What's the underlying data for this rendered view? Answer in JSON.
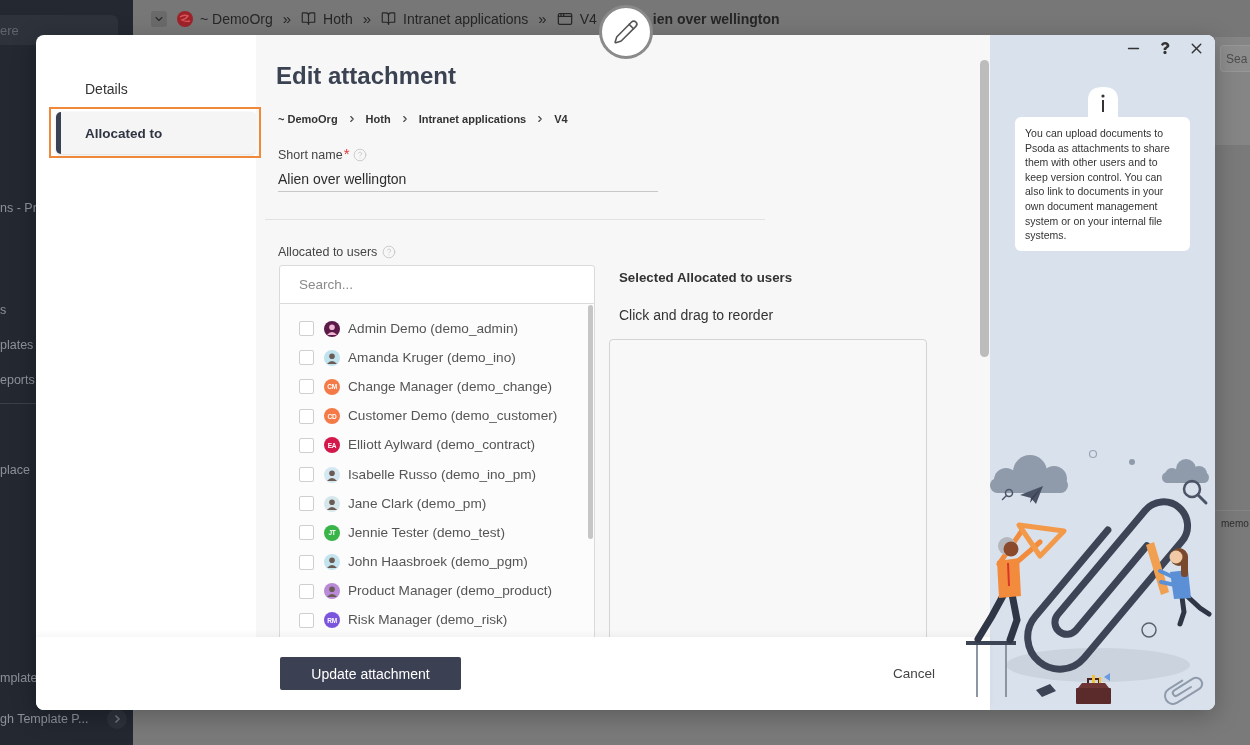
{
  "background": {
    "sidebar": {
      "search_placeholder": "ere",
      "groups": [
        {
          "items": [
            "ns - Pr"
          ]
        },
        {
          "items": [
            "s",
            "plates",
            "eports"
          ]
        },
        {
          "items": [
            "place"
          ]
        }
      ],
      "footer": [
        "mplate"
      ],
      "bottom_link": "gh Template P..."
    },
    "topbar": {
      "crumbs": [
        {
          "kind": "org",
          "label": "~ DemoOrg",
          "separator": "»",
          "current": false
        },
        {
          "kind": "group",
          "label": "Hoth",
          "separator": "»",
          "current": false
        },
        {
          "kind": "group",
          "label": "Intranet applications",
          "separator": "»",
          "current": false
        },
        {
          "kind": "item",
          "label": "V4",
          "current": false
        },
        {
          "kind": "plain",
          "label": "ien over wellington",
          "current": true
        }
      ]
    },
    "right_strip": {
      "search_placeholder": "Sea",
      "text": "memo"
    }
  },
  "modal": {
    "nav": [
      {
        "label": "Details",
        "selected": false,
        "highlighted": false
      },
      {
        "label": "Allocated to",
        "selected": true,
        "highlighted": true
      }
    ],
    "title": "Edit attachment",
    "path": [
      "~ DemoOrg",
      "Hoth",
      "Intranet applications",
      "V4"
    ],
    "short_name": {
      "label": "Short name",
      "required_mark": "*",
      "value": "Alien over wellington"
    },
    "users_field": {
      "label": "Allocated to users",
      "search_placeholder": "Search...",
      "users": [
        {
          "name": "Admin Demo (demo_admin)",
          "checked": false,
          "avatar": {
            "kind": "photo",
            "color": "#5c1a48"
          }
        },
        {
          "name": "Amanda Kruger (demo_ino)",
          "checked": false,
          "avatar": {
            "kind": "photo",
            "color": "#bfe2ef"
          }
        },
        {
          "name": "Change Manager (demo_change)",
          "checked": false,
          "avatar": {
            "kind": "initials",
            "initials": "CM",
            "color": "#f47b47"
          }
        },
        {
          "name": "Customer Demo (demo_customer)",
          "checked": false,
          "avatar": {
            "kind": "initials",
            "initials": "CD",
            "color": "#f47b47"
          }
        },
        {
          "name": "Elliott Aylward (demo_contract)",
          "checked": false,
          "avatar": {
            "kind": "initials",
            "initials": "EA",
            "color": "#d4184b"
          }
        },
        {
          "name": "Isabelle Russo (demo_ino_pm)",
          "checked": false,
          "avatar": {
            "kind": "photo",
            "color": "#d4e8f2"
          }
        },
        {
          "name": "Jane Clark (demo_pm)",
          "checked": false,
          "avatar": {
            "kind": "photo",
            "color": "#d6e7ec"
          }
        },
        {
          "name": "Jennie Tester (demo_test)",
          "checked": false,
          "avatar": {
            "kind": "initials",
            "initials": "JT",
            "color": "#38b449"
          }
        },
        {
          "name": "John Haasbroek (demo_pgm)",
          "checked": false,
          "avatar": {
            "kind": "photo",
            "color": "#c3e3ef"
          }
        },
        {
          "name": "Product Manager (demo_product)",
          "checked": false,
          "avatar": {
            "kind": "photo",
            "color": "#b98ad6"
          }
        },
        {
          "name": "Risk Manager (demo_risk)",
          "checked": false,
          "avatar": {
            "kind": "initials",
            "initials": "RM",
            "color": "#7c55dd"
          }
        }
      ]
    },
    "selected_panel": {
      "title": "Selected Allocated to users",
      "hint": "Click and drag to reorder"
    },
    "footer": {
      "primary_button": "Update attachment",
      "cancel_button": "Cancel"
    }
  },
  "help_panel": {
    "text": "You can upload documents to Psoda as attachments to share them with other users and to keep version control. You can also link to documents in your own document management system or on your internal file systems."
  }
}
